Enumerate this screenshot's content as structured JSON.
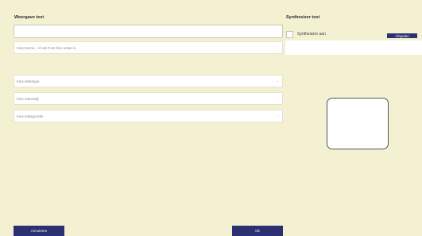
{
  "left": {
    "display_text_label": "Weergave text",
    "display_text_value": "",
    "theme_select": {
      "placeholder": "Kies thema , of stel Font hier onder in"
    },
    "font_select": {
      "placeholder": "Kies lettertype"
    },
    "style_select": {
      "placeholder": "Kies tekenstijl"
    },
    "size_select": {
      "placeholder": "Kies tekstgrootte"
    }
  },
  "right": {
    "synth_label": "Synthesizer text",
    "synth_checkbox_label": "Synthesizer aan",
    "synth_checkbox_checked": false,
    "play_button": "Afspelen",
    "synth_text_value": ""
  },
  "footer": {
    "cancel_button": "Annuleren",
    "ok_button": "Ok"
  },
  "icons": {
    "dropdown": "chevron-down-icon"
  },
  "colors": {
    "background": "#f3f1d2",
    "button": "#2c2f72",
    "preview_border": "#555555"
  }
}
